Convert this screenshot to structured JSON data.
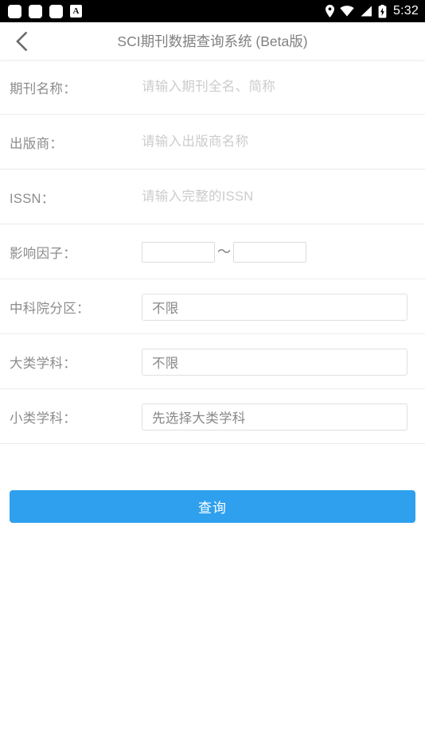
{
  "status_bar": {
    "notification_icons": [
      "app-square-icon",
      "app-square-icon",
      "app-square-icon",
      "letter-a-icon"
    ],
    "letter_badge": "A",
    "system_icons": [
      "location-pin-icon",
      "wifi-icon",
      "signal-icon",
      "battery-charging-icon"
    ],
    "time": "5:32",
    "background_color": "#000000",
    "foreground_color": "#ffffff"
  },
  "header": {
    "back_icon": "chevron-left-icon",
    "title": "SCI期刊数据查询系统 (Beta版)",
    "title_color": "#808080"
  },
  "form": {
    "rows": [
      {
        "label": "期刊名称：",
        "type": "text",
        "value": "",
        "placeholder": "请输入期刊全名、简称"
      },
      {
        "label": "出版商：",
        "type": "text",
        "value": "",
        "placeholder": "请输入出版商名称"
      },
      {
        "label": "ISSN：",
        "type": "text",
        "value": "",
        "placeholder": "请输入完整的ISSN"
      },
      {
        "label": "影响因子：",
        "type": "range",
        "min_value": "",
        "max_value": "",
        "min_placeholder": "",
        "max_placeholder": "",
        "separator": "～"
      },
      {
        "label": "中科院分区：",
        "type": "select",
        "value": "不限"
      },
      {
        "label": "大类学科：",
        "type": "select",
        "value": "不限"
      },
      {
        "label": "小类学科：",
        "type": "select",
        "value": "先选择大类学科"
      }
    ]
  },
  "submit": {
    "label": "查询",
    "color": "#2fa0ee",
    "text_color": "#ffffff"
  }
}
